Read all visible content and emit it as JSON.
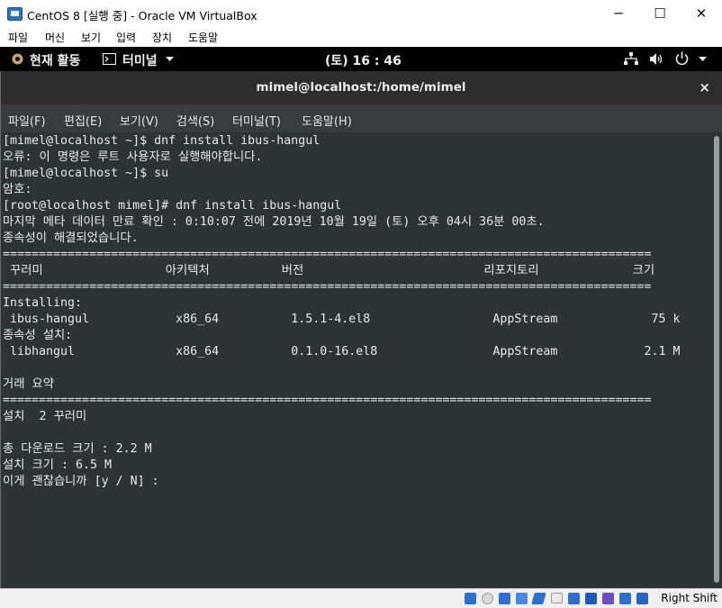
{
  "window": {
    "title": "CentOS 8 [실행 중] - Oracle VM VirtualBox",
    "controls": {
      "minimize": "─",
      "maximize": "☐",
      "close": "✕"
    },
    "menu": [
      "파일",
      "머신",
      "보기",
      "입력",
      "장치",
      "도움말"
    ]
  },
  "gnome_panel": {
    "activities": "현재 활동",
    "app_menu": "터미널",
    "clock": "(토) 16 : 46"
  },
  "terminal": {
    "title": "mimel@localhost:/home/mimel",
    "close": "×",
    "menu": [
      "파일(F)",
      "편집(E)",
      "보기(V)",
      "검색(S)",
      "터미널(T)",
      "도움말(H)"
    ],
    "lines": [
      "[mimel@localhost ~]$ dnf install ibus-hangul",
      "오류: 이 명령은 루트 사용자로 실행해야합니다.",
      "[mimel@localhost ~]$ su",
      "암호:",
      "[root@localhost mimel]# dnf install ibus-hangul",
      "마지막 메타 데이터 만료 확인 : 0:10:07 전에 2019년 10월 19일 (토) 오후 04시 36분 00초.",
      "종속성이 해결되었습니다.",
      "==========================================================================================",
      " 꾸러미                 아키텍처          버전                         리포지토리             크기",
      "==========================================================================================",
      "Installing:",
      " ibus-hangul            x86_64          1.5.1-4.el8                 AppStream             75 k",
      "종속성 설치:",
      " libhangul              x86_64          0.1.0-16.el8                AppStream            2.1 M",
      "",
      "거래 요약",
      "==========================================================================================",
      "설치  2 꾸러미",
      "",
      "총 다운로드 크기 : 2.2 M",
      "설치 크기 : 6.5 M",
      "이게 괜찮습니까 [y / N] :"
    ]
  },
  "statusbar": {
    "host_key": "Right Shift",
    "icons": [
      "hdd-icon",
      "optical-icon",
      "audio-icon",
      "network-icon",
      "usb-icon",
      "shared-folder-icon",
      "display-icon",
      "recording-icon",
      "vrde-icon",
      "cpu-icon",
      "mouse-icon",
      "keyboard-icon"
    ],
    "colors": {
      "blue": "#2f6fce",
      "gray": "#8a8a8a"
    }
  }
}
